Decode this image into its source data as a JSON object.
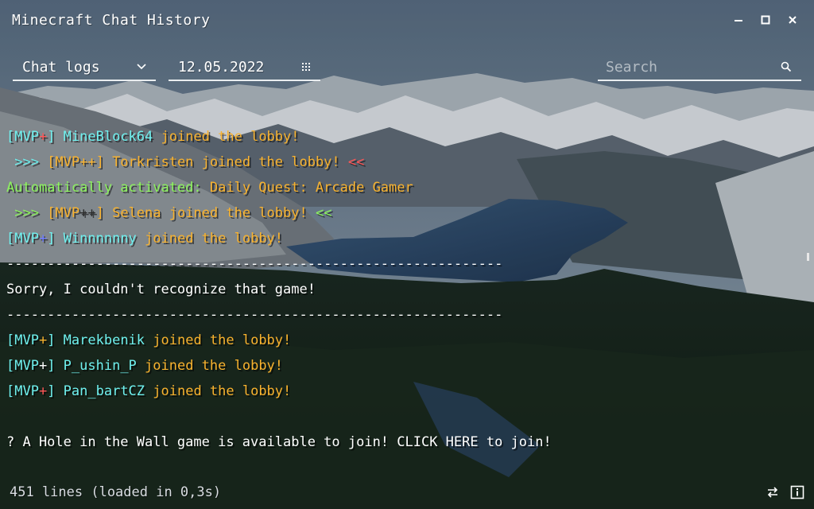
{
  "window": {
    "title": "Minecraft Chat History",
    "controls": [
      "minimize-icon",
      "maximize-icon",
      "close-icon"
    ]
  },
  "toolbar": {
    "log_type": {
      "selected": "Chat logs",
      "icon": "chevron-down-icon"
    },
    "date": {
      "value": "12.05.2022",
      "icon": "calendar-icon"
    },
    "search": {
      "placeholder": "Search",
      "icon": "search-icon"
    }
  },
  "chat": {
    "lines": [
      {
        "segments": [
          {
            "text": "[MVP",
            "color": "cyan"
          },
          {
            "text": "+",
            "color": "red"
          },
          {
            "text": "] MineBlock64",
            "color": "cyan"
          },
          {
            "text": " joined the lobby!",
            "color": "gold"
          }
        ]
      },
      {
        "segments": [
          {
            "text": " >>> ",
            "color": "cyan"
          },
          {
            "text": "[MVP++] Torkristen joined the lobby!",
            "color": "gold"
          },
          {
            "text": " <<",
            "color": "red"
          }
        ]
      },
      {
        "segments": [
          {
            "text": "Automatically activated: ",
            "color": "green"
          },
          {
            "text": "Daily Quest: Arcade Gamer",
            "color": "gold"
          }
        ]
      },
      {
        "segments": [
          {
            "text": " >>> ",
            "color": "green"
          },
          {
            "text": "[MVP",
            "color": "gold"
          },
          {
            "text": "++",
            "color": "black"
          },
          {
            "text": "] Selena joined the lobby!",
            "color": "gold"
          },
          {
            "text": " <<",
            "color": "green"
          }
        ]
      },
      {
        "segments": [
          {
            "text": "[MVP",
            "color": "cyan"
          },
          {
            "text": "+",
            "color": "blue"
          },
          {
            "text": "] Winnnnnny",
            "color": "cyan"
          },
          {
            "text": " joined the lobby!",
            "color": "gold"
          }
        ]
      },
      {
        "segments": [
          {
            "text": "-------------------------------------------------------------",
            "color": "white"
          }
        ]
      },
      {
        "segments": [
          {
            "text": "Sorry, I couldn't recognize that game!",
            "color": "white"
          }
        ]
      },
      {
        "segments": [
          {
            "text": "-------------------------------------------------------------",
            "color": "white"
          }
        ]
      },
      {
        "segments": [
          {
            "text": "[MVP",
            "color": "cyan"
          },
          {
            "text": "+",
            "color": "gold"
          },
          {
            "text": "] Marekbenik",
            "color": "cyan"
          },
          {
            "text": " joined the lobby!",
            "color": "gold"
          }
        ]
      },
      {
        "segments": [
          {
            "text": "[MVP",
            "color": "cyan"
          },
          {
            "text": "+",
            "color": "white"
          },
          {
            "text": "] P_ushin_P",
            "color": "cyan"
          },
          {
            "text": " joined the lobby!",
            "color": "gold"
          }
        ]
      },
      {
        "segments": [
          {
            "text": "[MVP",
            "color": "cyan"
          },
          {
            "text": "+",
            "color": "red"
          },
          {
            "text": "] Pan_bartCZ",
            "color": "cyan"
          },
          {
            "text": " joined the lobby!",
            "color": "gold"
          }
        ]
      },
      {
        "segments": [
          {
            "text": "",
            "color": "white"
          }
        ]
      },
      {
        "segments": [
          {
            "text": "? A Hole in the Wall game is available to join! CLICK HERE to join!",
            "color": "white"
          }
        ]
      }
    ]
  },
  "status": {
    "text": "451 lines (loaded in 0,3s)",
    "icons": [
      "swap-icon",
      "info-icon"
    ]
  },
  "colors": {
    "cyan": "#6ff0ee",
    "gold": "#f8b22e",
    "red": "#ff5656",
    "green": "#8cf35d",
    "white": "#ffffff",
    "blue": "#6d7bff",
    "black": "#2a2a2a"
  }
}
